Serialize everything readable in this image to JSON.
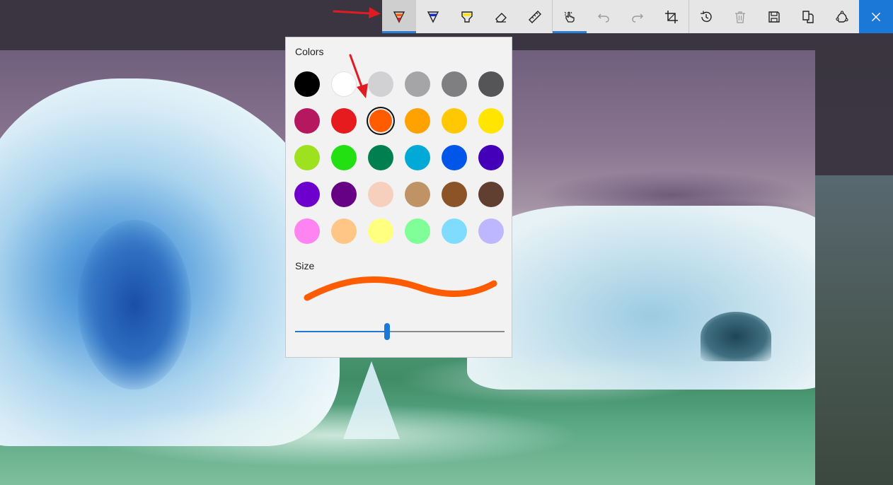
{
  "toolbar": {
    "items": [
      {
        "name": "ballpoint-pen",
        "icon": "pen-icon"
      },
      {
        "name": "pencil",
        "icon": "pencil-icon"
      },
      {
        "name": "highlighter",
        "icon": "highlighter-icon"
      },
      {
        "name": "eraser",
        "icon": "eraser-icon"
      },
      {
        "name": "ruler",
        "icon": "ruler-icon"
      },
      {
        "name": "touch-writing",
        "icon": "touch-writing-icon"
      },
      {
        "name": "undo",
        "icon": "undo-icon"
      },
      {
        "name": "redo",
        "icon": "redo-icon"
      },
      {
        "name": "crop",
        "icon": "crop-icon"
      },
      {
        "name": "replay",
        "icon": "history-icon"
      },
      {
        "name": "delete",
        "icon": "trash-icon"
      },
      {
        "name": "save",
        "icon": "save-icon"
      },
      {
        "name": "copy",
        "icon": "copy-icon"
      },
      {
        "name": "share",
        "icon": "share-icon"
      },
      {
        "name": "close",
        "icon": "close-icon"
      }
    ],
    "active_item": "ballpoint-pen",
    "accent_color": "#1b78d6"
  },
  "flyout": {
    "colors_heading": "Colors",
    "size_heading": "Size",
    "selected_color": "#ff5b00",
    "size_value": 0.44,
    "colors": [
      [
        "#000000",
        "#ffffff",
        "#d1d1d3",
        "#a5a5a8",
        "#7f7f82",
        "#555557"
      ],
      [
        "#b5185e",
        "#e51b1e",
        "#ff5b00",
        "#ffa200",
        "#ffc800",
        "#ffe500"
      ],
      [
        "#9ee11f",
        "#22e012",
        "#008051",
        "#00a9d6",
        "#0056e8",
        "#4300b8"
      ],
      [
        "#6d00cc",
        "#660084",
        "#f6d0bd",
        "#bf9365",
        "#8c5327",
        "#603e30"
      ],
      [
        "#ff83f0",
        "#ffc686",
        "#ffff80",
        "#80ff99",
        "#80dcff",
        "#bdb7ff"
      ]
    ]
  }
}
